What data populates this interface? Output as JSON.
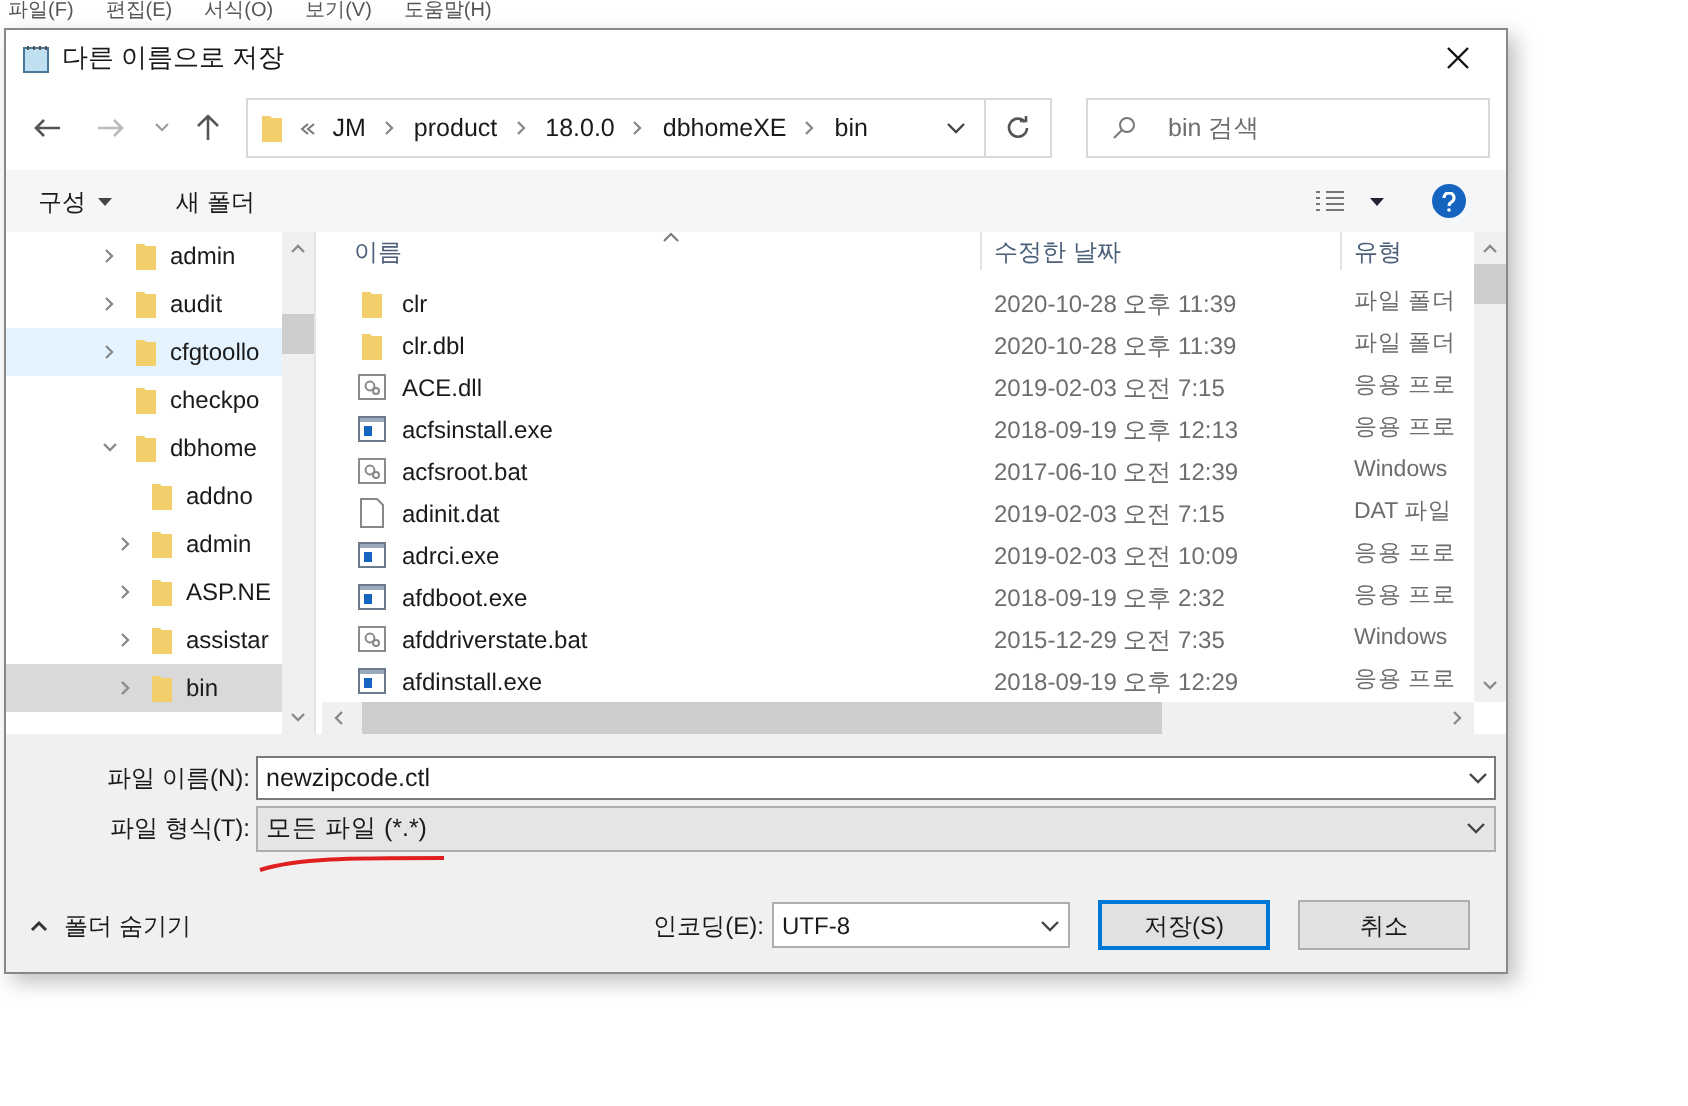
{
  "background_menu": [
    "파일(F)",
    "편집(E)",
    "서식(O)",
    "보기(V)",
    "도움말(H)"
  ],
  "window": {
    "title": "다른 이름으로 저장"
  },
  "address": {
    "crumbs": [
      "JM",
      "product",
      "18.0.0",
      "dbhomeXE",
      "bin"
    ]
  },
  "search": {
    "placeholder": "bin 검색"
  },
  "toolbar": {
    "organize": "구성",
    "new_folder": "새 폴더"
  },
  "tree": [
    {
      "label": "admin",
      "expandable": true,
      "expanded": false,
      "selected": false,
      "hovered": false
    },
    {
      "label": "audit",
      "expandable": true,
      "expanded": false,
      "selected": false,
      "hovered": false
    },
    {
      "label": "cfgtoollo",
      "expandable": true,
      "expanded": false,
      "selected": false,
      "hovered": true
    },
    {
      "label": "checkpo",
      "expandable": false,
      "selected": false,
      "hovered": false
    },
    {
      "label": "dbhome",
      "expandable": true,
      "expanded": true,
      "selected": false,
      "hovered": false,
      "children": [
        {
          "label": "addno",
          "expandable": false,
          "selected": false,
          "hovered": false
        },
        {
          "label": "admin",
          "expandable": true,
          "expanded": false,
          "selected": false,
          "hovered": false
        },
        {
          "label": "ASP.NE",
          "expandable": true,
          "expanded": false,
          "selected": false,
          "hovered": false
        },
        {
          "label": "assistar",
          "expandable": true,
          "expanded": false,
          "selected": false,
          "hovered": false
        },
        {
          "label": "bin",
          "expandable": true,
          "expanded": false,
          "selected": true,
          "hovered": false
        }
      ]
    }
  ],
  "table": {
    "columns": [
      "이름",
      "수정한 날짜",
      "유형"
    ],
    "rows": [
      {
        "kind": "folder",
        "name": "clr",
        "date": "2020-10-28 오후 11:39",
        "type": "파일 폴더"
      },
      {
        "kind": "folder",
        "name": "clr.dbl",
        "date": "2020-10-28 오후 11:39",
        "type": "파일 폴더"
      },
      {
        "kind": "dll",
        "name": "ACE.dll",
        "date": "2019-02-03 오전 7:15",
        "type": "응용 프로"
      },
      {
        "kind": "exe",
        "name": "acfsinstall.exe",
        "date": "2018-09-19 오후 12:13",
        "type": "응용 프로"
      },
      {
        "kind": "bat",
        "name": "acfsroot.bat",
        "date": "2017-06-10 오전 12:39",
        "type": "Windows"
      },
      {
        "kind": "dat",
        "name": "adinit.dat",
        "date": "2019-02-03 오전 7:15",
        "type": "DAT 파일"
      },
      {
        "kind": "exe",
        "name": "adrci.exe",
        "date": "2019-02-03 오전 10:09",
        "type": "응용 프로"
      },
      {
        "kind": "exe",
        "name": "afdboot.exe",
        "date": "2018-09-19 오후 2:32",
        "type": "응용 프로"
      },
      {
        "kind": "bat",
        "name": "afddriverstate.bat",
        "date": "2015-12-29 오전 7:35",
        "type": "Windows"
      },
      {
        "kind": "exe",
        "name": "afdinstall.exe",
        "date": "2018-09-19 오후 12:29",
        "type": "응용 프로"
      }
    ]
  },
  "file_name": {
    "label": "파일 이름(N):",
    "value": "newzipcode.ctl"
  },
  "file_type": {
    "label": "파일 형식(T):",
    "value": "모든 파일 (*.*)"
  },
  "hide_folders": "폴더 숨기기",
  "encoding": {
    "label": "인코딩(E):",
    "value": "UTF-8"
  },
  "buttons": {
    "save": "저장(S)",
    "cancel": "취소"
  }
}
